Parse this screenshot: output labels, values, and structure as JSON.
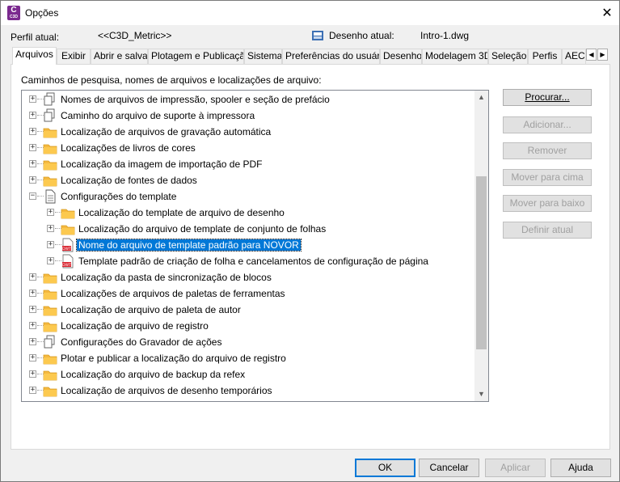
{
  "window": {
    "title": "Opções",
    "close_glyph": "✕",
    "app_icon_letter": "C",
    "app_icon_sub": "C3D"
  },
  "profile": {
    "profile_label": "Perfil atual:",
    "profile_value": "<<C3D_Metric>>",
    "drawing_label": "Desenho atual:",
    "drawing_value": "Intro-1.dwg"
  },
  "tabs": [
    {
      "label": "Arquivos",
      "active": true
    },
    {
      "label": "Exibir"
    },
    {
      "label": "Abrir e salvar"
    },
    {
      "label": "Plotagem e Publicação"
    },
    {
      "label": "Sistema"
    },
    {
      "label": "Preferências do usuário"
    },
    {
      "label": "Desenho"
    },
    {
      "label": "Modelagem 3D"
    },
    {
      "label": "Seleção"
    },
    {
      "label": "Perfis"
    },
    {
      "label": "AEC"
    }
  ],
  "tab_scroll": {
    "left": "◀",
    "right": "▶"
  },
  "panel": {
    "label": "Caminhos de pesquisa, nomes de arquivos e localizações de arquivo:"
  },
  "tree": [
    {
      "label": "Nomes de arquivos de impressão, spooler e seção de prefácio",
      "icon": "pages-icon",
      "level": 0,
      "expander": "+"
    },
    {
      "label": "Caminho do arquivo de suporte à impressora",
      "icon": "pages-icon",
      "level": 0,
      "expander": "+"
    },
    {
      "label": "Localização de arquivos de gravação automática",
      "icon": "folder-icon",
      "level": 0,
      "expander": "+"
    },
    {
      "label": "Localizações de livros de cores",
      "icon": "folder-icon",
      "level": 0,
      "expander": "+"
    },
    {
      "label": "Localização da imagem de importação de PDF",
      "icon": "folder-icon",
      "level": 0,
      "expander": "+"
    },
    {
      "label": "Localização de fontes de dados",
      "icon": "folder-icon",
      "level": 0,
      "expander": "+"
    },
    {
      "label": "Configurações do template",
      "icon": "document-icon",
      "level": 0,
      "expander": "−"
    },
    {
      "label": "Localização do template de arquivo de desenho",
      "icon": "folder-icon",
      "level": 1,
      "expander": "+"
    },
    {
      "label": "Localização do arquivo de template de conjunto de folhas",
      "icon": "folder-icon",
      "level": 1,
      "expander": "+"
    },
    {
      "label": "Nome do arquivo de template padrão para NOVOR",
      "icon": "dwt-file-icon",
      "level": 1,
      "expander": "+",
      "selected": true
    },
    {
      "label": "Template padrão de criação de folha e cancelamentos de configuração de página",
      "icon": "dwt-file-icon",
      "level": 1,
      "expander": "+"
    },
    {
      "label": "Localização da pasta de sincronização de blocos",
      "icon": "folder-icon",
      "level": 0,
      "expander": "+"
    },
    {
      "label": "Localizações de arquivos de paletas de ferramentas",
      "icon": "folder-icon",
      "level": 0,
      "expander": "+"
    },
    {
      "label": "Localização de arquivo de paleta de autor",
      "icon": "folder-icon",
      "level": 0,
      "expander": "+"
    },
    {
      "label": "Localização de arquivo de registro",
      "icon": "folder-icon",
      "level": 0,
      "expander": "+"
    },
    {
      "label": "Configurações do Gravador de ações",
      "icon": "pages-icon",
      "level": 0,
      "expander": "+"
    },
    {
      "label": "Plotar e publicar a localização do arquivo de registro",
      "icon": "folder-icon",
      "level": 0,
      "expander": "+"
    },
    {
      "label": "Localização do arquivo de backup da refex",
      "icon": "folder-icon",
      "level": 0,
      "expander": "+"
    },
    {
      "label": "Localização de arquivos de desenho temporários",
      "icon": "folder-icon",
      "level": 0,
      "expander": "+"
    }
  ],
  "scrollbar": {
    "up": "▲",
    "down": "▼",
    "position": 0.42
  },
  "side_buttons": [
    {
      "label": "Procurar...",
      "enabled": true
    },
    {
      "label": "Adicionar...",
      "enabled": false
    },
    {
      "label": "Remover",
      "enabled": false
    },
    {
      "label": "Mover para cima",
      "enabled": false
    },
    {
      "label": "Mover para baixo",
      "enabled": false
    },
    {
      "label": "Definir atual",
      "enabled": false
    }
  ],
  "bottom_buttons": [
    {
      "label": "OK",
      "enabled": true,
      "default": true
    },
    {
      "label": "Cancelar",
      "enabled": true
    },
    {
      "label": "Aplicar",
      "enabled": false
    },
    {
      "label": "Ajuda",
      "enabled": true
    }
  ],
  "colors": {
    "selection": "#0078d7",
    "folder": "#f5b940",
    "dwt_red": "#d9232e"
  }
}
